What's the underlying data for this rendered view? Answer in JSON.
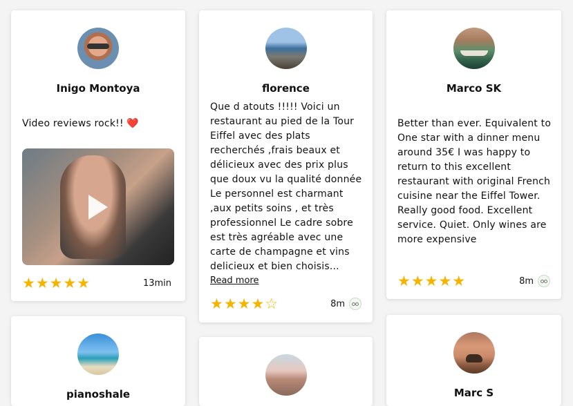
{
  "reviews": [
    {
      "name": "Inigo Montoya",
      "text": "Video reviews rock!!",
      "emoji": "❤️",
      "stars": "★★★★★",
      "rating": 5,
      "time": "13min",
      "avatar": "person-sunglasses-avatar",
      "has_video": true
    },
    {
      "name": "florence",
      "text": "Que d atouts !!!!! Voici un restaurant au pied de la Tour Eiffel avec des plats recherchés ,frais beaux et délicieux avec des prix plus que doux vu la qualité donnée Le personnel est charmant ,aux petits soins , et très professionnel Le cadre sobre est très agréable avec une carte de champagne et vins delicieux et bien choisis...",
      "read_more": "Read more",
      "stars": "★★★★☆",
      "rating": 4,
      "time": "8m",
      "avatar": "coastline-avatar",
      "source_icon": "tripadvisor-icon"
    },
    {
      "name": "Marco SK",
      "text": "Better than ever. Equivalent to One star with a dinner menu around 35€ I was happy to return to this excellent restaurant with original French cuisine near the Eiffel Tower. Really good food. Excellent service. Quiet. Only wines are more expensive",
      "stars": "★★★★★",
      "rating": 5,
      "time": "8m",
      "avatar": "boat-avatar",
      "source_icon": "tripadvisor-icon"
    },
    {
      "name": "pianoshale",
      "avatar": "beach-palm-avatar"
    },
    {
      "name": "",
      "avatar": "pier-avatar"
    },
    {
      "name": "Marc S",
      "avatar": "bison-avatar"
    }
  ],
  "colors": {
    "star": "#f4b400",
    "background": "#f4f4f4",
    "card": "#ffffff"
  }
}
